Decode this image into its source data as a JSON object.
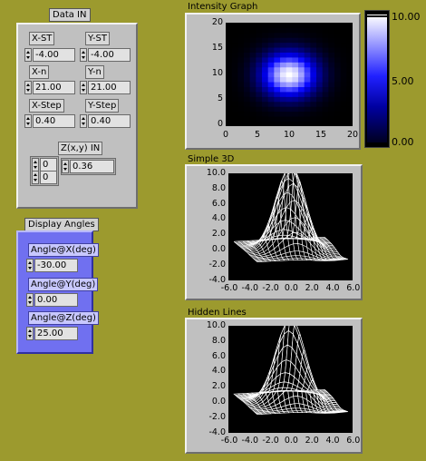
{
  "data_in": {
    "title": "Data IN",
    "x_st": {
      "label": "X-ST",
      "value": "-4.00"
    },
    "y_st": {
      "label": "Y-ST",
      "value": "-4.00"
    },
    "x_n": {
      "label": "X-n",
      "value": "21.00"
    },
    "y_n": {
      "label": "Y-n",
      "value": "21.00"
    },
    "x_step": {
      "label": "X-Step",
      "value": "0.40"
    },
    "y_step": {
      "label": "Y-Step",
      "value": "0.40"
    },
    "zxy": {
      "label": "Z(x,y) IN",
      "index0": "0",
      "index1": "0",
      "value": "0.36"
    }
  },
  "display_angles": {
    "title": "Display Angles",
    "angle_x": {
      "label": "Angle@X(deg)",
      "value": "-30.00"
    },
    "angle_y": {
      "label": "Angle@Y(deg)",
      "value": "0.00"
    },
    "angle_z": {
      "label": "Angle@Z(deg)",
      "value": "25.00"
    }
  },
  "intensity_graph": {
    "title": "Intensity Graph",
    "x_ticks": [
      "0",
      "5",
      "10",
      "15",
      "20"
    ],
    "y_ticks": [
      "20",
      "15",
      "10",
      "5",
      "0"
    ],
    "colorbar_ticks": [
      "10.00",
      "5.00",
      "0.00"
    ]
  },
  "simple_3d": {
    "title": "Simple 3D",
    "y_ticks": [
      "10.0",
      "8.0",
      "6.0",
      "4.0",
      "2.0",
      "0.0",
      "-2.0",
      "-4.0"
    ],
    "x_ticks": [
      "-6.0",
      "-4.0",
      "-2.0",
      "0.0",
      "2.0",
      "4.0",
      "6.0"
    ]
  },
  "hidden_lines": {
    "title": "Hidden Lines",
    "y_ticks": [
      "10.0",
      "8.0",
      "6.0",
      "4.0",
      "2.0",
      "0.0",
      "-2.0",
      "-4.0"
    ],
    "x_ticks": [
      "-6.0",
      "-4.0",
      "-2.0",
      "0.0",
      "2.0",
      "4.0",
      "6.0"
    ]
  },
  "colors": {
    "background": "#9c9a2e",
    "panel": "#c0c0c0",
    "angles_panel": "#7070f0",
    "plot_bg": "#000000",
    "intensity_high": "#ffffff",
    "intensity_mid": "#0000ff"
  }
}
